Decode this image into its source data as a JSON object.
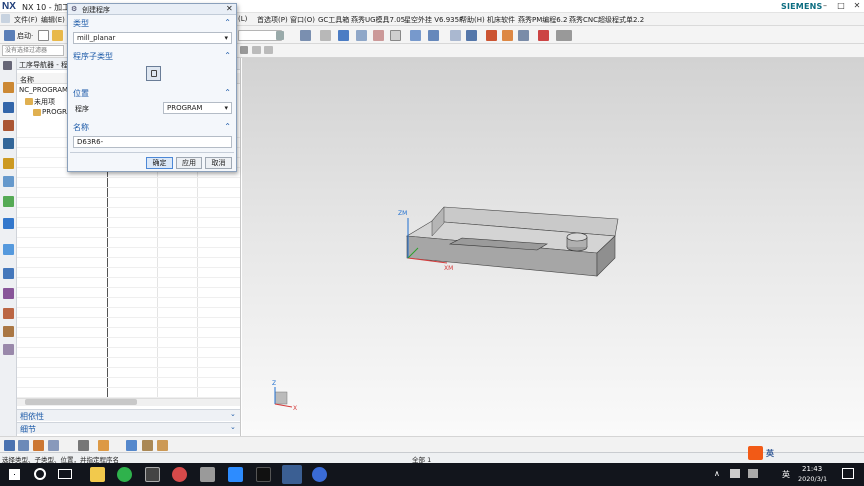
{
  "app": {
    "logo": "NX",
    "window_title": "NX 10 - 加工 -",
    "brand": "SIEMENS"
  },
  "window_controls": [
    "?",
    "–",
    "□",
    "✕"
  ],
  "menu": {
    "left": [
      "文件(F)",
      "编辑(E)"
    ],
    "right": [
      "(L)",
      "首选项(P)",
      "窗口(O)",
      "GC工具箱",
      "燕秀UG模具7.05",
      "星空外挂 V6.935F",
      "帮助(H)",
      "机床软件",
      "燕秀PM编程6.2",
      "燕秀CNC超级程式单2.2"
    ]
  },
  "toolbar": {
    "start_label": "启动·"
  },
  "selbar": {
    "filter_placeholder": "没有选择过滤器"
  },
  "navigator": {
    "title": "工序导航器 - 程",
    "column_name": "名称",
    "rows": [
      "NC_PROGRAM",
      "未用项",
      "PROGRA"
    ],
    "bottom_sections": [
      "相依性",
      "细节"
    ]
  },
  "dialog": {
    "title": "创建程序",
    "type_section": "类型",
    "type_value": "mill_planar",
    "subtype_section": "程序子类型",
    "location_section": "位置",
    "program_label": "程序",
    "program_value": "PROGRAM",
    "name_section": "名称",
    "name_value": "D63R6-",
    "ok": "确定",
    "apply": "应用",
    "cancel": "取消"
  },
  "viewport": {
    "axis_zm": "ZM",
    "axis_xm": "XM",
    "triad_z": "Z",
    "triad_x": "X",
    "triad_y": "Y"
  },
  "status": {
    "prompt": "选择类型、子类型、位置，并指定程序名",
    "selection": "全部 1"
  },
  "taskbar": {
    "ime": "英",
    "time": "21:43",
    "date": "2020/3/1"
  },
  "colors": {
    "accent": "#1c5aa8",
    "titlebar_dialog": "#e8eef6",
    "taskbar": "#12151c"
  }
}
